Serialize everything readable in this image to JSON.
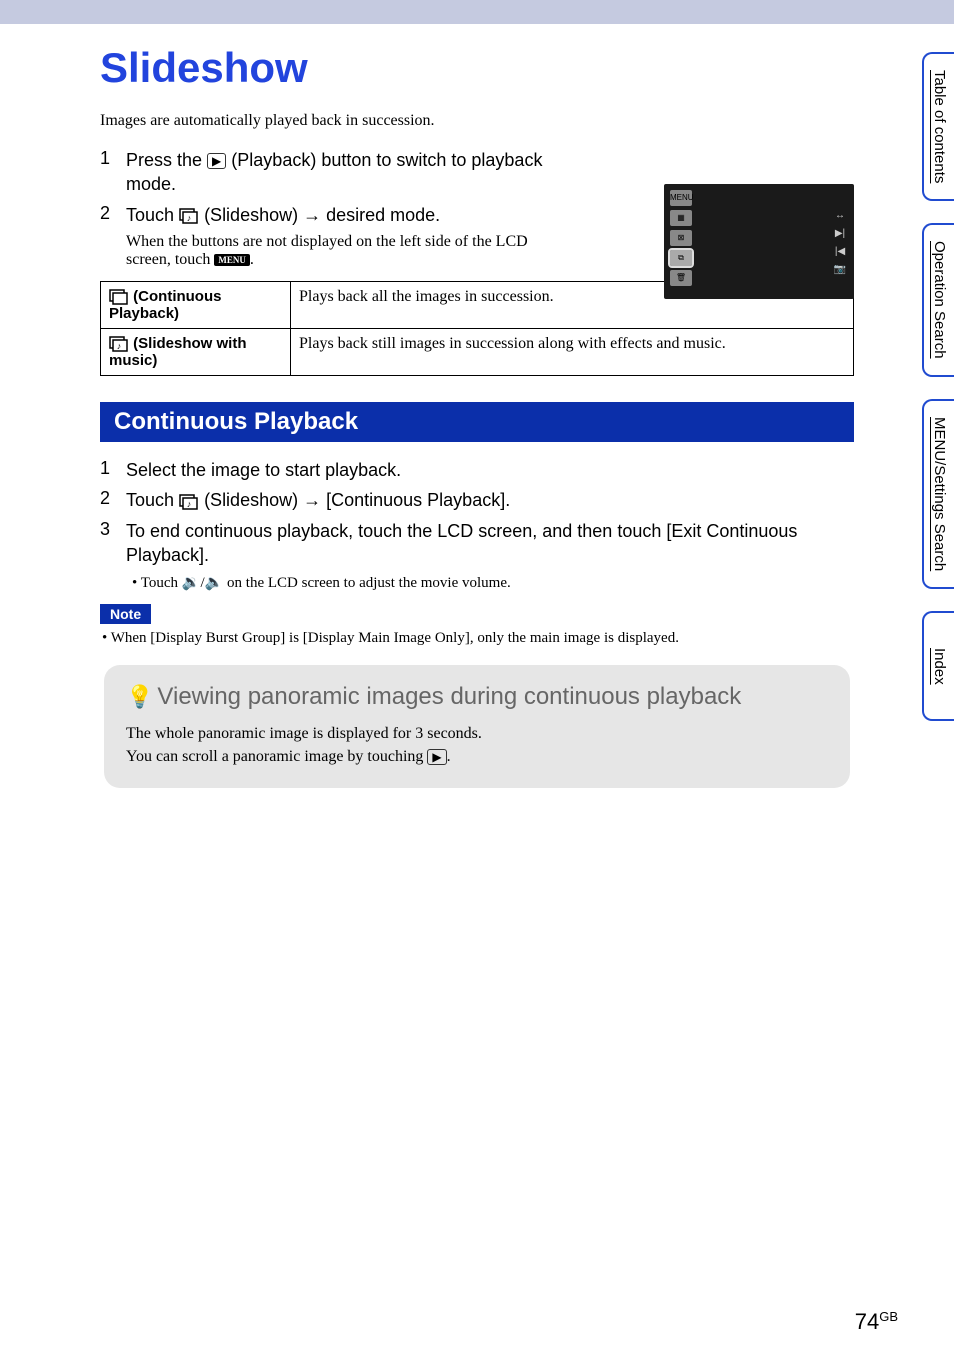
{
  "title": "Slideshow",
  "intro": "Images are automatically played back in succession.",
  "steps_main": [
    {
      "num": "1",
      "text_before": "Press the ",
      "icon": "playback-button-icon",
      "text_after": " (Playback) button to switch to playback mode."
    },
    {
      "num": "2",
      "text_before": "Touch ",
      "icon": "slideshow-icon",
      "text_after": " (Slideshow) → desired mode.",
      "sub_before": "When the buttons are not displayed on the left side of the LCD screen, touch ",
      "sub_badge": "MENU",
      "sub_after": "."
    }
  ],
  "modes_table": [
    {
      "icon": "continuous-playback-icon",
      "label": " (Continuous Playback)",
      "desc": "Plays back all the images in succession."
    },
    {
      "icon": "slideshow-music-icon",
      "label": " (Slideshow with music)",
      "desc": "Plays back still images in succession along with effects and music."
    }
  ],
  "section_heading": "Continuous Playback",
  "cp_steps": [
    {
      "num": "1",
      "text": "Select the image to start playback."
    },
    {
      "num": "2",
      "text_before": "Touch ",
      "icon": "slideshow-icon",
      "text_after": " (Slideshow) → [Continuous Playback]."
    },
    {
      "num": "3",
      "text": "To end continuous playback, touch the LCD screen, and then touch [Exit Continuous Playback]."
    }
  ],
  "cp_bullet_before": "Touch ",
  "cp_bullet_icons": "🔉/🔈",
  "cp_bullet_after": " on the LCD screen to adjust the movie volume.",
  "note_label": "Note",
  "note_text": "When [Display Burst Group] is [Display Main Image Only], only the main image is displayed.",
  "tip_title": "Viewing panoramic images during continuous playback",
  "tip_body_line1": "The whole panoramic image is displayed for 3 seconds.",
  "tip_body_line2_before": "You can scroll a panoramic image by touching ",
  "tip_body_line2_icon": "▶",
  "tip_body_line2_after": ".",
  "side_tabs": [
    "Table of contents",
    "Operation Search",
    "MENU/Settings Search",
    "Index"
  ],
  "page_number": "74",
  "page_suffix": "GB",
  "lcd_left": [
    "MENU",
    "▦",
    "⊠",
    "⧉",
    "🗑"
  ],
  "lcd_right": [
    "↔",
    "▶|",
    "|◀",
    "📷"
  ]
}
